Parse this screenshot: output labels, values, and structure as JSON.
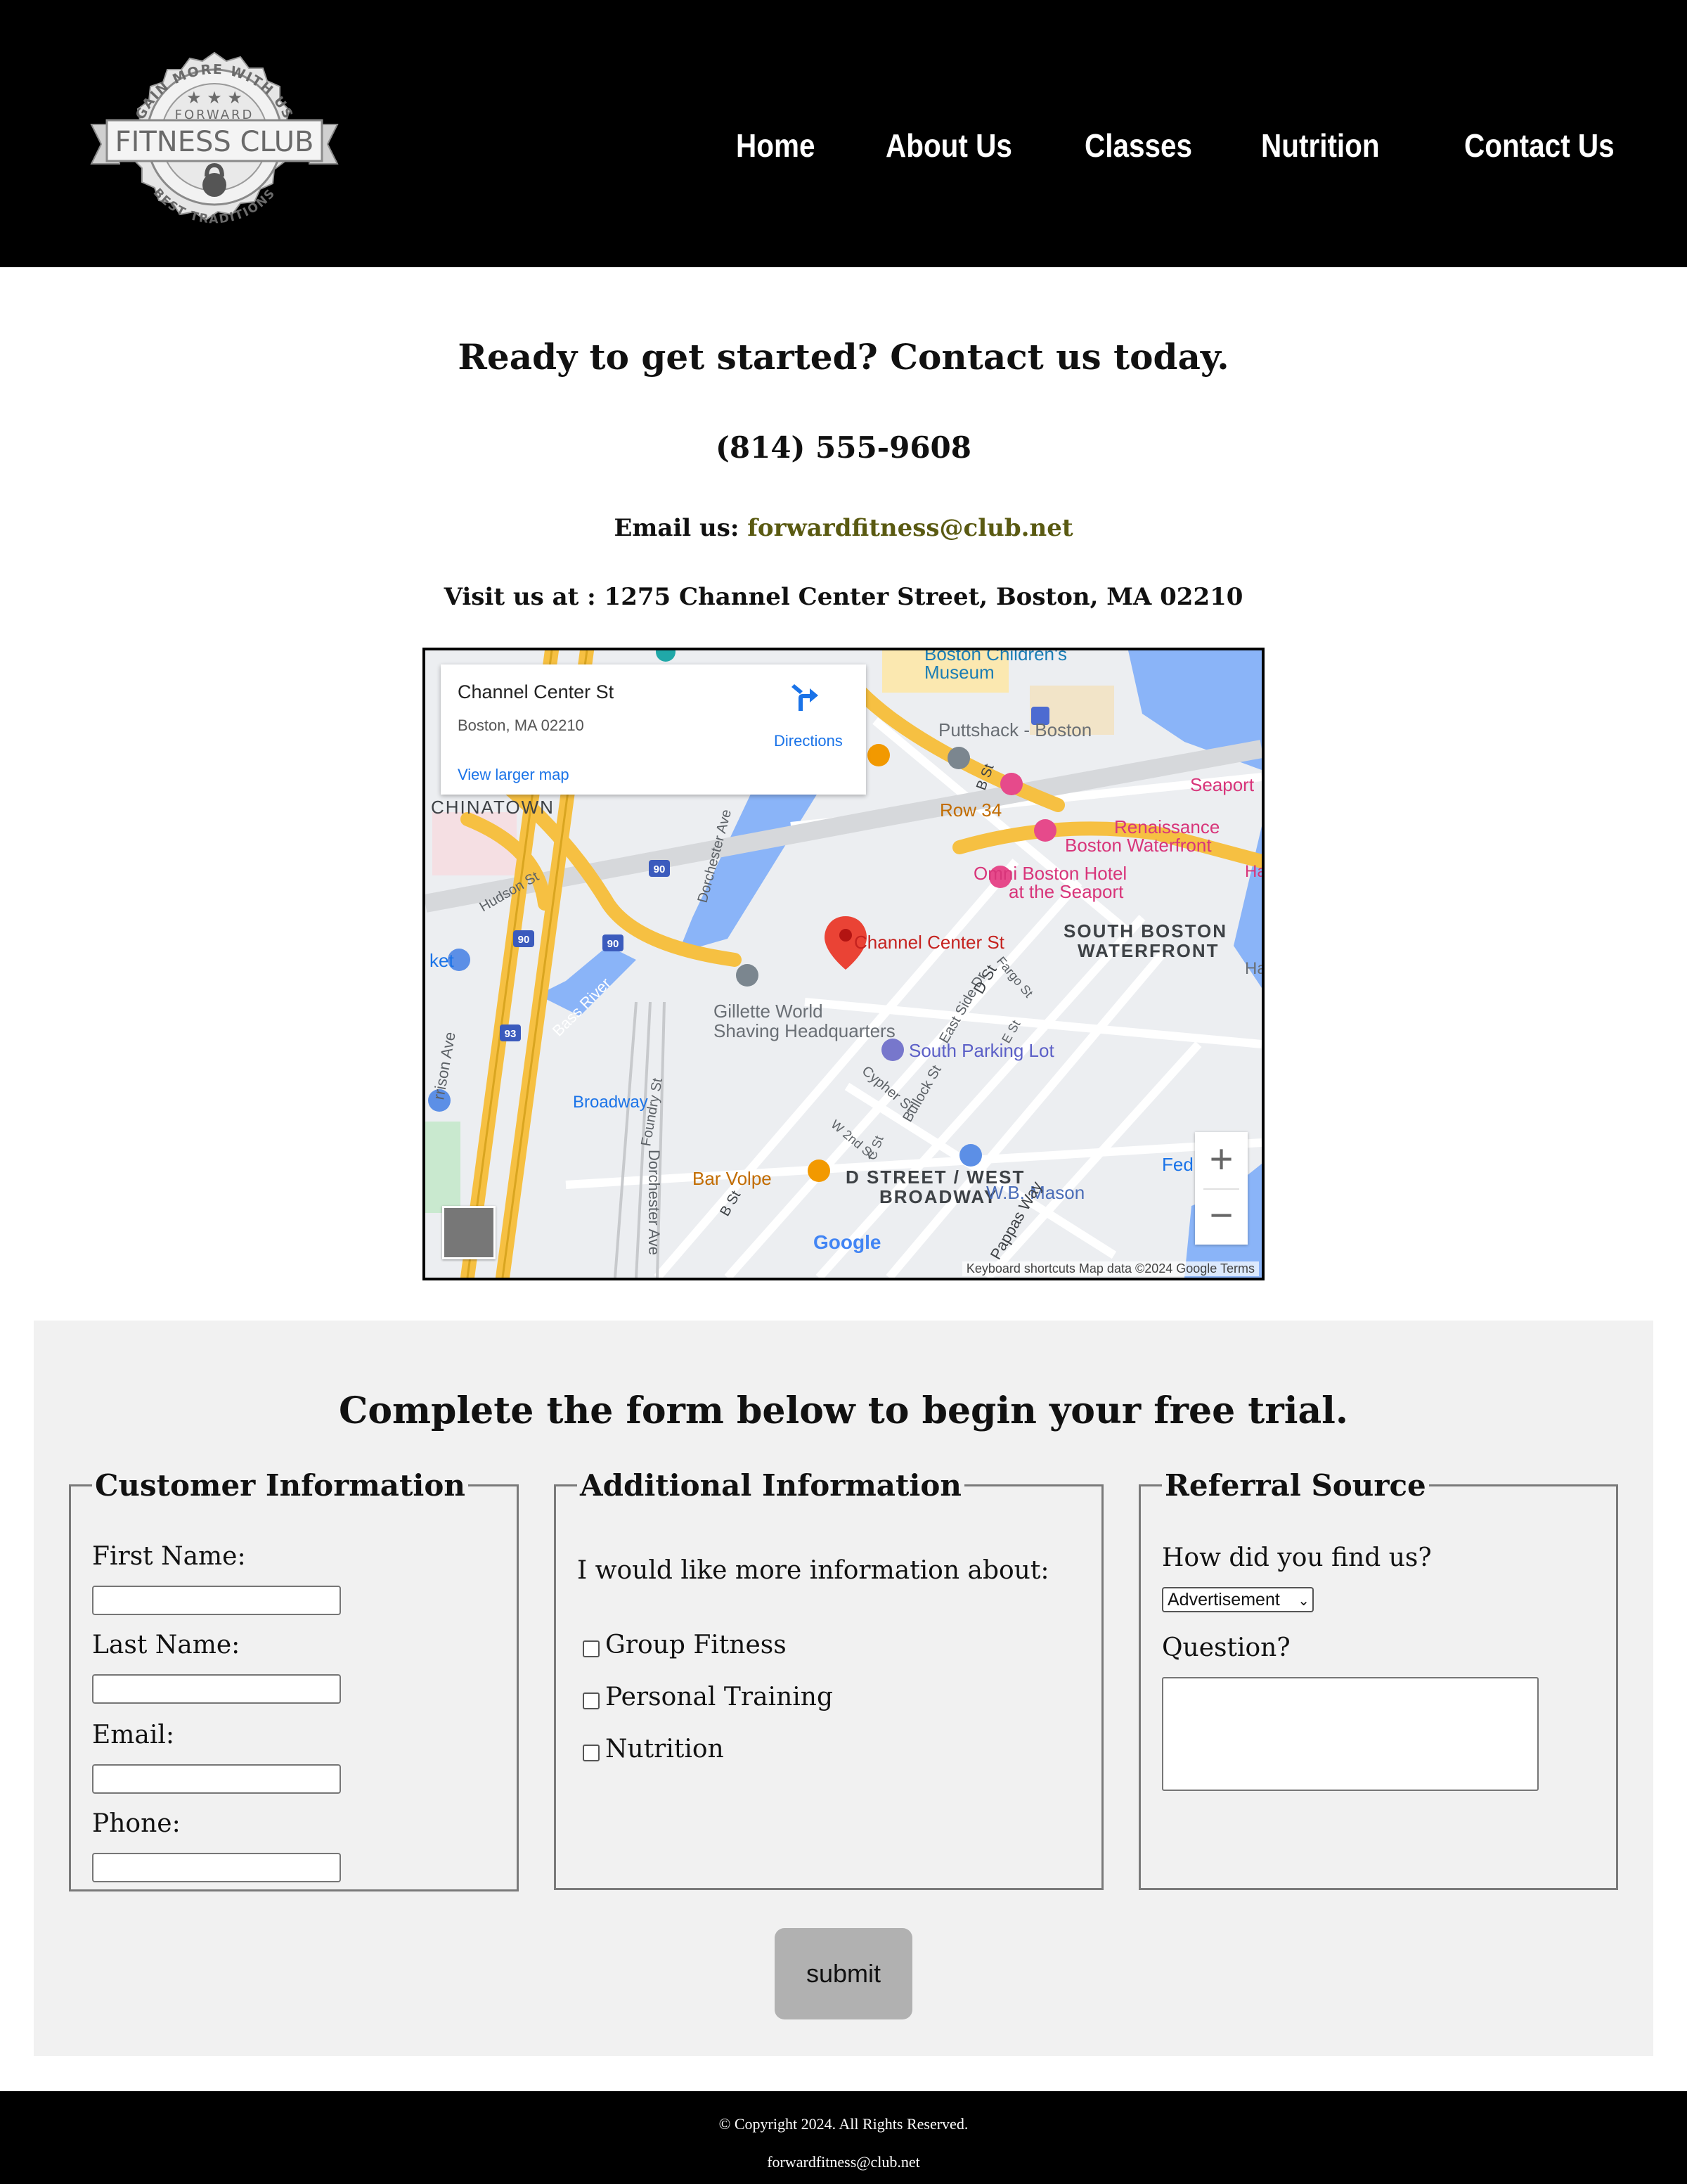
{
  "header": {
    "logo": {
      "arc_top": "GAIN MORE WITH US",
      "sub": "FORWARD",
      "banner": "FITNESS CLUB",
      "arc_bottom": "BEST TRADITIONS"
    },
    "nav": [
      {
        "label": "Home"
      },
      {
        "label": "About Us"
      },
      {
        "label": "Classes"
      },
      {
        "label": "Nutrition"
      },
      {
        "label": "Contact Us"
      }
    ]
  },
  "contact": {
    "heading": "Ready to get started? Contact us today.",
    "phone": "(814) 555-9608",
    "email_prefix": "Email us: ",
    "email": "forwardfitness@club.net",
    "visit": "Visit us at : 1275 Channel Center Street, Boston, MA 02210"
  },
  "map": {
    "place_title": "Channel Center St",
    "place_address": "Boston, MA 02210",
    "larger_map_link": "View larger map",
    "directions_label": "Directions",
    "pin_label": "Channel Center St",
    "labels": {
      "boston_childrens": "Boston Children's",
      "museum": "Museum",
      "puttshack": "Puttshack - Boston",
      "chinatown": "CHINATOWN",
      "row34": "Row 34",
      "seaport": "Seaport",
      "renaissance": "Renaissance",
      "boston_waterfront": "Boston Waterfront",
      "omni": "Omni Boston Hotel",
      "at_seaport": "at the Seaport",
      "south_boston": "SOUTH BOSTON",
      "waterfront": "WATERFRONT",
      "gillette1": "Gillette World",
      "gillette2": "Shaving Headquarters",
      "south_parking": "South Parking Lot",
      "broadway": "Broadway",
      "bar_volpe": "Bar Volpe",
      "d_street": "D STREET / WEST",
      "broadway_caps": "BROADWAY",
      "wb_mason": "W.B. Mason",
      "bass_river": "Bass River",
      "hudson_st": "Hudson St",
      "dorchester_ave": "Dorchester Ave",
      "foundry_st": "Foundry St",
      "cypher_st": "Cypher St",
      "bullock_st": "Bullock St",
      "east_side_dr": "East Side Dr",
      "fargo_st": "Fargo St",
      "d_st": "D St",
      "b_st": "B St",
      "e_st": "E St",
      "w_2nd_st": "W 2nd St",
      "c_st": "C St",
      "pappas_way": "Pappas Way",
      "ket": "ket",
      "rrison_ave": "rrison Ave",
      "fed": "Fed",
      "ha": "Ha",
      "route_90": "90",
      "route_93": "93"
    },
    "zoom_in": "+",
    "zoom_out": "−",
    "google": "Google",
    "attribution": "Keyboard shortcuts  Map data ©2024 Google   Terms"
  },
  "form": {
    "title": "Complete the form below to begin your free trial.",
    "customer": {
      "legend": "Customer Information",
      "first_name": "First Name:",
      "last_name": "Last Name:",
      "email": "Email:",
      "phone": "Phone:"
    },
    "additional": {
      "legend": "Additional Information",
      "intro": "I would like more information about:",
      "options": [
        "Group Fitness",
        "Personal Training",
        "Nutrition"
      ]
    },
    "referral": {
      "legend": "Referral Source",
      "how_label": "How did you find us?",
      "how_selected": "Advertisement",
      "question_label": "Question?"
    },
    "submit_label": "submit"
  },
  "footer": {
    "copyright": "© Copyright 2024. All Rights Reserved.",
    "email": "forwardfitness@club.net"
  },
  "colors": {
    "header_bg": "#000000",
    "email_link": "#5a5a12",
    "form_bg": "#f1f1f1",
    "submit_bg": "#b1b1b1",
    "map_highway": "#f6c042",
    "map_water": "#8ab4f8"
  }
}
